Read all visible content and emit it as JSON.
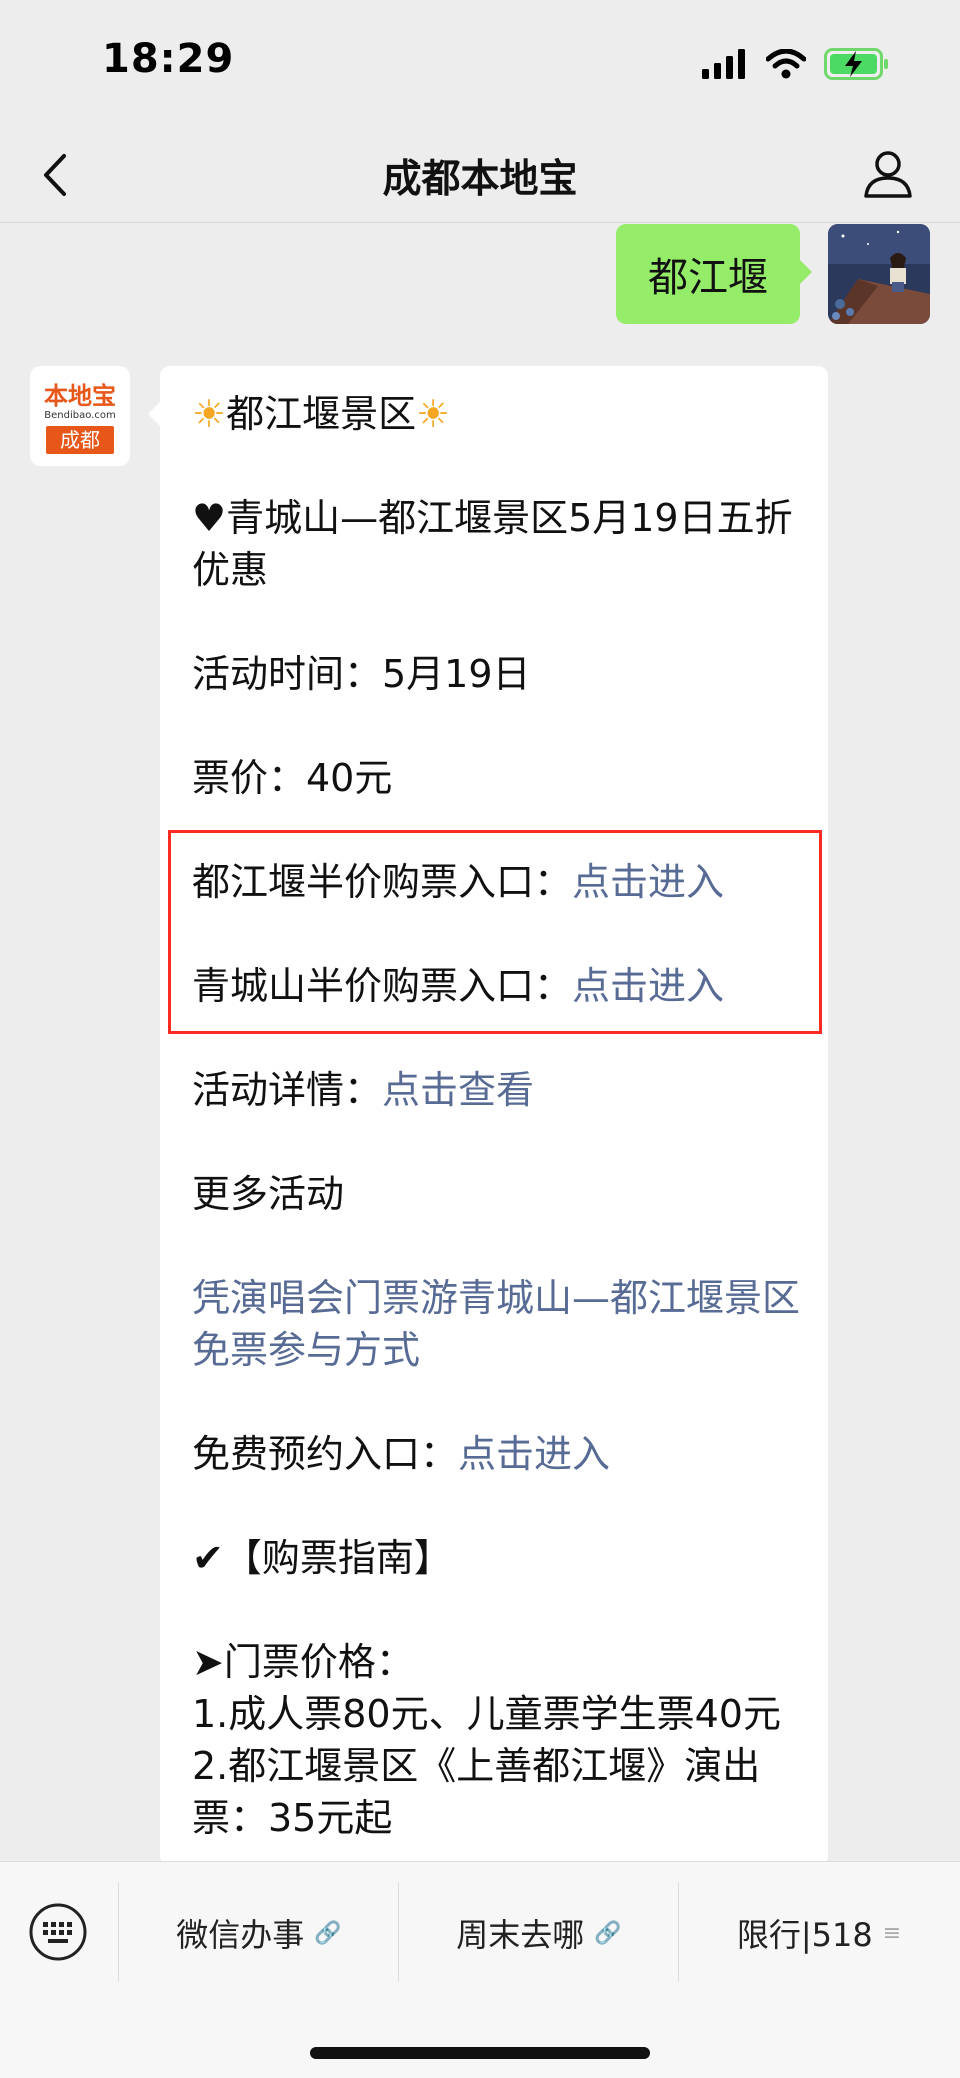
{
  "status": {
    "time": "18:29"
  },
  "nav": {
    "title": "成都本地宝"
  },
  "user_message": {
    "text": "都江堰"
  },
  "bot_logo": {
    "top": "本地宝",
    "mid": "Bendibao.com",
    "bottom": "成都"
  },
  "card": {
    "title_sun_left": "☀",
    "title": "都江堰景区",
    "title_sun_right": "☀",
    "headline": "♥青城山—都江堰景区5月19日五折优惠",
    "activity_time": "活动时间：5月19日",
    "price": "票价：40元",
    "dujiangyan_label": "都江堰半价购票入口：",
    "dujiangyan_link": "点击进入",
    "qingcheng_label": "青城山半价购票入口：",
    "qingcheng_link": "点击进入",
    "details_label": "活动详情：",
    "details_link": "点击查看",
    "more": "更多活动",
    "concert_link": "凭演唱会门票游青城山—都江堰景区免票参与方式",
    "free_label": "免费预约入口：",
    "free_link": "点击进入",
    "guide": "✔【购票指南】",
    "ticket_price": "➤门票价格：",
    "line1": "1.成人票80元、儿童票学生票40元",
    "line2": "2.都江堰景区《上善都江堰》演出票：35元起"
  },
  "bottom_menu": {
    "item1": "微信办事",
    "item2": "周末去哪",
    "item3": "限行|518"
  },
  "colors": {
    "link": "#576b95",
    "bubble_green": "#95ec69",
    "highlight": "#ff2a22"
  }
}
